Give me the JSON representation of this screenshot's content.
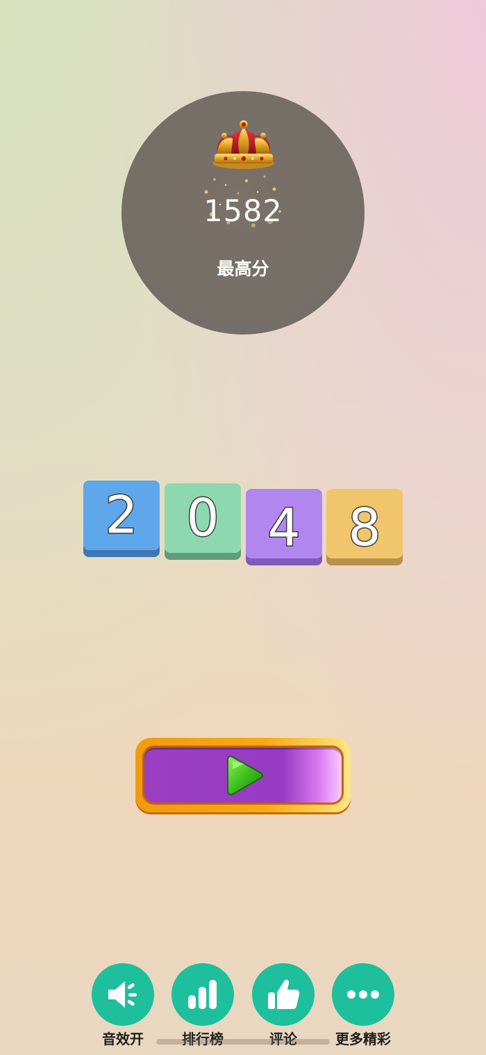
{
  "best_score": {
    "value": "1582",
    "label": "最高分",
    "crown_icon": "crown-icon"
  },
  "logo": {
    "tiles": [
      {
        "digit": "2",
        "color": "#5ea7ea",
        "shadow": "#3f77b5"
      },
      {
        "digit": "0",
        "color": "#8ed8b0",
        "shadow": "#5f9b7c"
      },
      {
        "digit": "4",
        "color": "#b187ef",
        "shadow": "#7f5ab8"
      },
      {
        "digit": "8",
        "color": "#f0c56b",
        "shadow": "#b8914a"
      }
    ]
  },
  "play_button": {
    "icon": "play-icon",
    "frame_color": "#f09b0e",
    "fill_color": "#963cc3"
  },
  "bottom_bar": {
    "items": [
      {
        "label": "音效开",
        "icon": "sound-on-icon"
      },
      {
        "label": "排行榜",
        "icon": "leaderboard-icon"
      },
      {
        "label": "评论",
        "icon": "thumbs-up-icon"
      },
      {
        "label": "更多精彩",
        "icon": "more-icon"
      }
    ],
    "button_color": "#1dbf9d"
  }
}
